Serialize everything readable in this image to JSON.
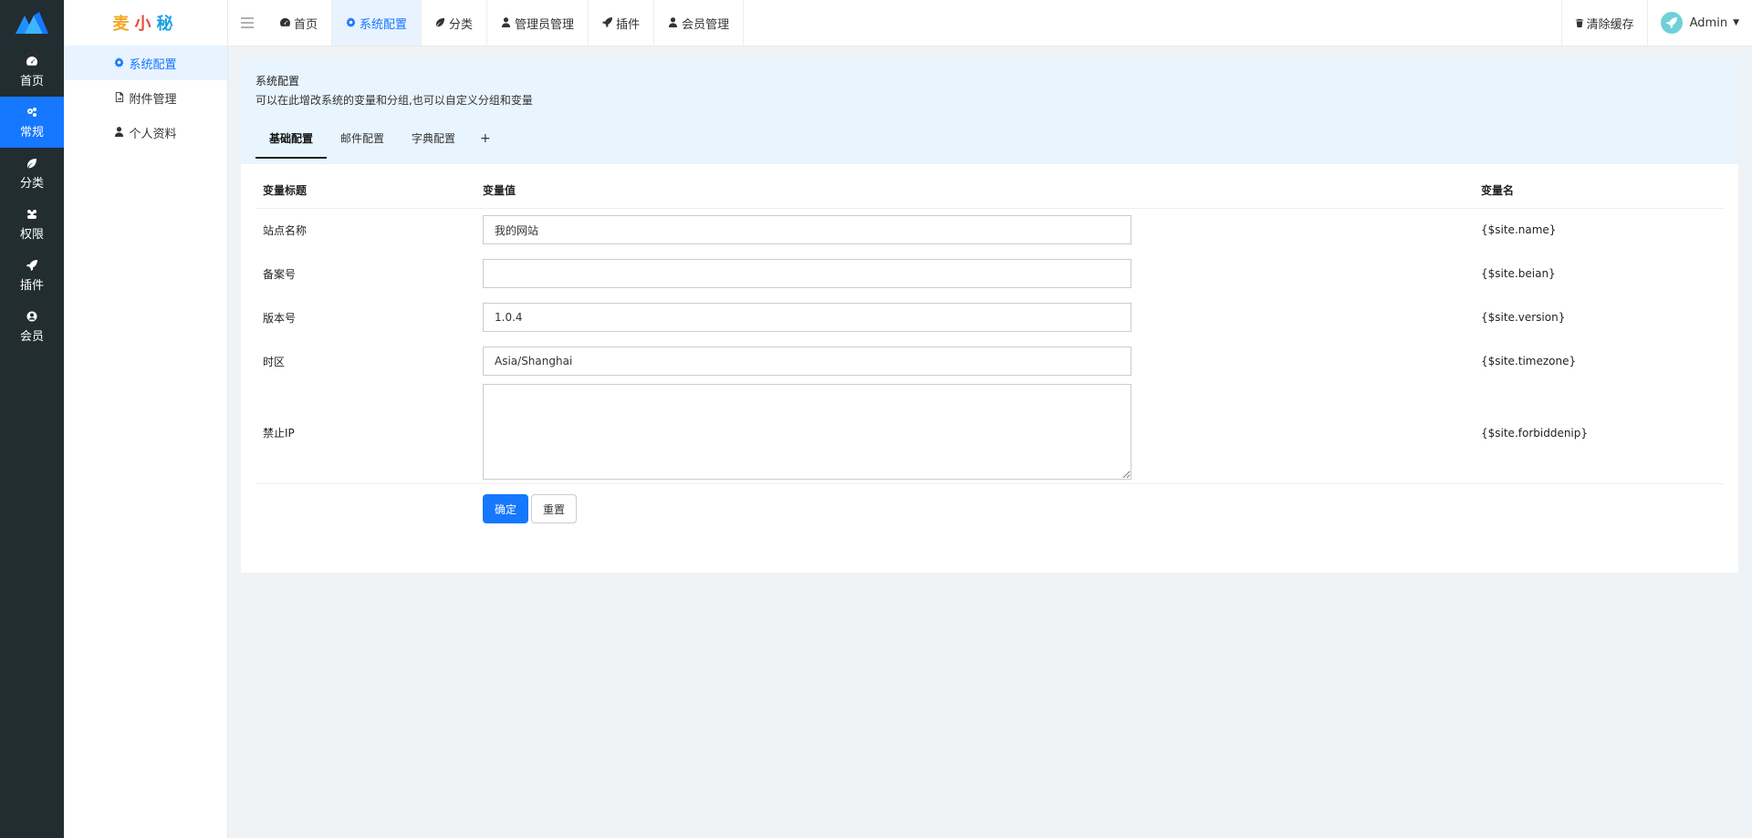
{
  "rail": {
    "items": [
      {
        "label": "首页",
        "icon": "dashboard-icon"
      },
      {
        "label": "常规",
        "icon": "cogs-icon",
        "active": true
      },
      {
        "label": "分类",
        "icon": "leaf-icon"
      },
      {
        "label": "权限",
        "icon": "group-icon"
      },
      {
        "label": "插件",
        "icon": "rocket-icon"
      },
      {
        "label": "会员",
        "icon": "user-circle-icon"
      }
    ]
  },
  "brand": {
    "char1": "麦",
    "char2": "小",
    "char3": "秘"
  },
  "side": {
    "items": [
      {
        "label": "系统配置",
        "icon": "gear-icon",
        "active": true
      },
      {
        "label": "附件管理",
        "icon": "file-image-icon"
      },
      {
        "label": "个人资料",
        "icon": "user-icon"
      }
    ]
  },
  "topnav": {
    "items": [
      {
        "label": "首页",
        "icon": "dashboard-icon"
      },
      {
        "label": "系统配置",
        "icon": "gear-icon",
        "active": true
      },
      {
        "label": "分类",
        "icon": "leaf-icon"
      },
      {
        "label": "管理员管理",
        "icon": "user-icon"
      },
      {
        "label": "插件",
        "icon": "rocket-icon"
      },
      {
        "label": "会员管理",
        "icon": "user-icon"
      }
    ],
    "clear_cache": "清除缓存",
    "username": "Admin"
  },
  "panel": {
    "title": "系统配置",
    "description": "可以在此增改系统的变量和分组,也可以自定义分组和变量",
    "tabs": [
      "基础配置",
      "邮件配置",
      "字典配置",
      "+"
    ]
  },
  "table": {
    "headers": [
      "变量标题",
      "变量值",
      "变量名"
    ],
    "rows": [
      {
        "title": "站点名称",
        "value": "我的网站",
        "name": "{$site.name}"
      },
      {
        "title": "备案号",
        "value": "",
        "name": "{$site.beian}"
      },
      {
        "title": "版本号",
        "value": "1.0.4",
        "name": "{$site.version}"
      },
      {
        "title": "时区",
        "value": "Asia/Shanghai",
        "name": "{$site.timezone}"
      },
      {
        "title": "禁止IP",
        "value": "",
        "name": "{$site.forbiddenip}"
      }
    ]
  },
  "buttons": {
    "submit": "确定",
    "reset": "重置"
  },
  "colors": {
    "primary": "#1677ff",
    "rail_bg": "#222d32",
    "panel_head_bg": "#e8f4fe"
  }
}
